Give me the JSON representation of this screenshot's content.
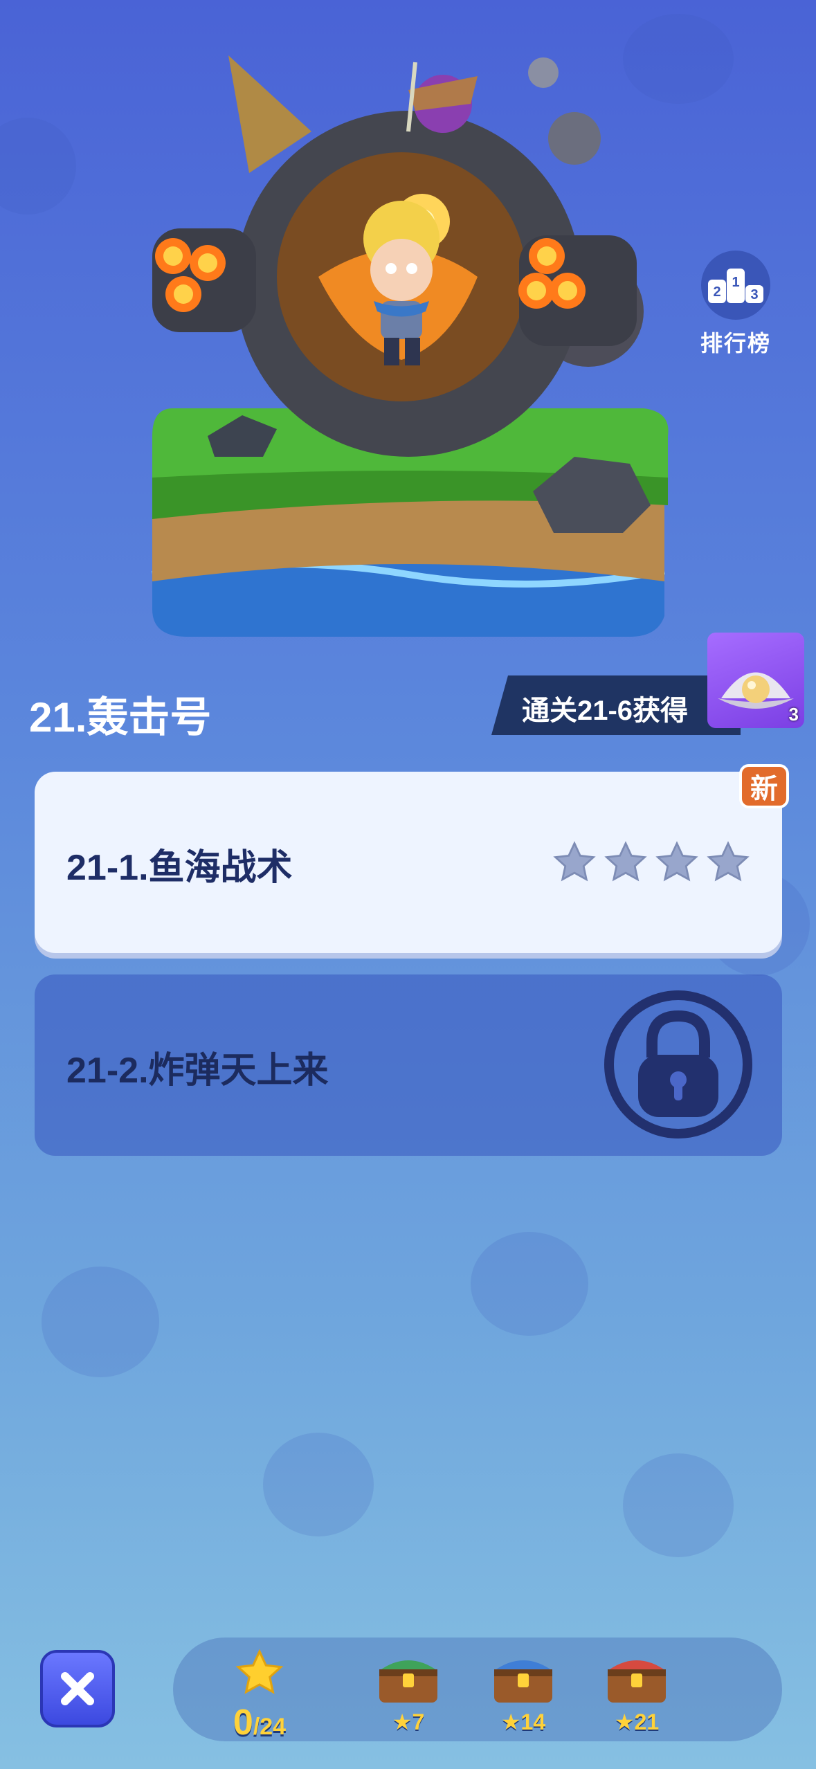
{
  "leaderboard": {
    "label": "排行榜",
    "icon": "podium-icon"
  },
  "chapter": {
    "title": "21.轰击号"
  },
  "reward": {
    "text": "通关21-6获得",
    "icon": "pearl-shell-icon",
    "count": "3"
  },
  "stages": [
    {
      "title": "21-1.鱼海战术",
      "stars_earned": 0,
      "stars_max": 4,
      "badge": "新",
      "locked": false
    },
    {
      "title": "21-2.炸弹天上来",
      "locked": true
    }
  ],
  "bottom": {
    "stars_collected": "0",
    "stars_total": "/24",
    "chests": [
      {
        "req": "7",
        "color": "#3fa35a"
      },
      {
        "req": "14",
        "color": "#3f7ed6"
      },
      {
        "req": "21",
        "color": "#d64a3f"
      }
    ]
  },
  "colors": {
    "accent": "#ffd23a",
    "banner": "#1f3463",
    "badge": "#e26b2b"
  }
}
